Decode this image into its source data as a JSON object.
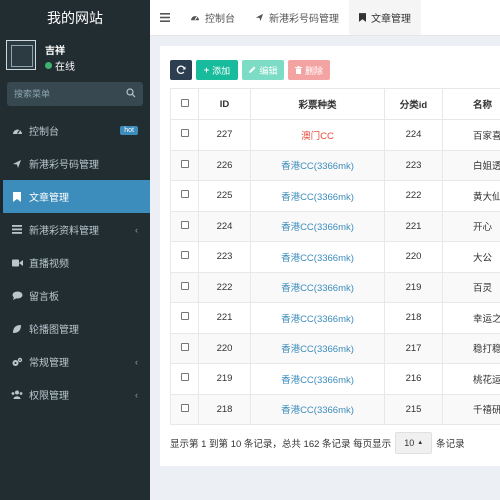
{
  "brand": "我的网站",
  "user": {
    "name": "吉祥",
    "status": "在线"
  },
  "search": {
    "placeholder": "搜索菜单"
  },
  "sidebar": {
    "items": [
      {
        "label": "控制台",
        "badge": "hot"
      },
      {
        "label": "新港彩号码管理"
      },
      {
        "label": "文章管理"
      },
      {
        "label": "新港彩资料管理"
      },
      {
        "label": "直播视频"
      },
      {
        "label": "留言板"
      },
      {
        "label": "轮播图管理"
      },
      {
        "label": "常规管理"
      },
      {
        "label": "权限管理"
      }
    ]
  },
  "tabs": [
    {
      "label": "控制台"
    },
    {
      "label": "新港彩号码管理"
    },
    {
      "label": "文章管理"
    }
  ],
  "toolbar": {
    "add": "添加",
    "edit": "编辑",
    "delete": "删除"
  },
  "table": {
    "headers": [
      "ID",
      "彩票种类",
      "分类id",
      "名称"
    ],
    "rows": [
      {
        "id": "227",
        "type": "澳门CC",
        "cat": "224",
        "name": "百家喜"
      },
      {
        "id": "226",
        "type": "香港CC(3366mk)",
        "cat": "223",
        "name": "白姐透"
      },
      {
        "id": "225",
        "type": "香港CC(3366mk)",
        "cat": "222",
        "name": "黄大仙"
      },
      {
        "id": "224",
        "type": "香港CC(3366mk)",
        "cat": "221",
        "name": "开心"
      },
      {
        "id": "223",
        "type": "香港CC(3366mk)",
        "cat": "220",
        "name": "大公"
      },
      {
        "id": "222",
        "type": "香港CC(3366mk)",
        "cat": "219",
        "name": "百灵"
      },
      {
        "id": "221",
        "type": "香港CC(3366mk)",
        "cat": "218",
        "name": "幸运之"
      },
      {
        "id": "220",
        "type": "香港CC(3366mk)",
        "cat": "217",
        "name": "稳打稳"
      },
      {
        "id": "219",
        "type": "香港CC(3366mk)",
        "cat": "216",
        "name": "桃花运"
      },
      {
        "id": "218",
        "type": "香港CC(3366mk)",
        "cat": "215",
        "name": "千禧研"
      }
    ]
  },
  "pager": {
    "summary": "显示第 1 到第 10 条记录，总共 162 条记录 每页显示",
    "size": "10",
    "suffix": "条记录"
  },
  "colors": {
    "sidebar": "#222d32",
    "active": "#3c8dbc",
    "add": "#18bc9c",
    "delete": "#f4a3a3",
    "link": "#3c8dbc",
    "red": "#e74c3c"
  }
}
